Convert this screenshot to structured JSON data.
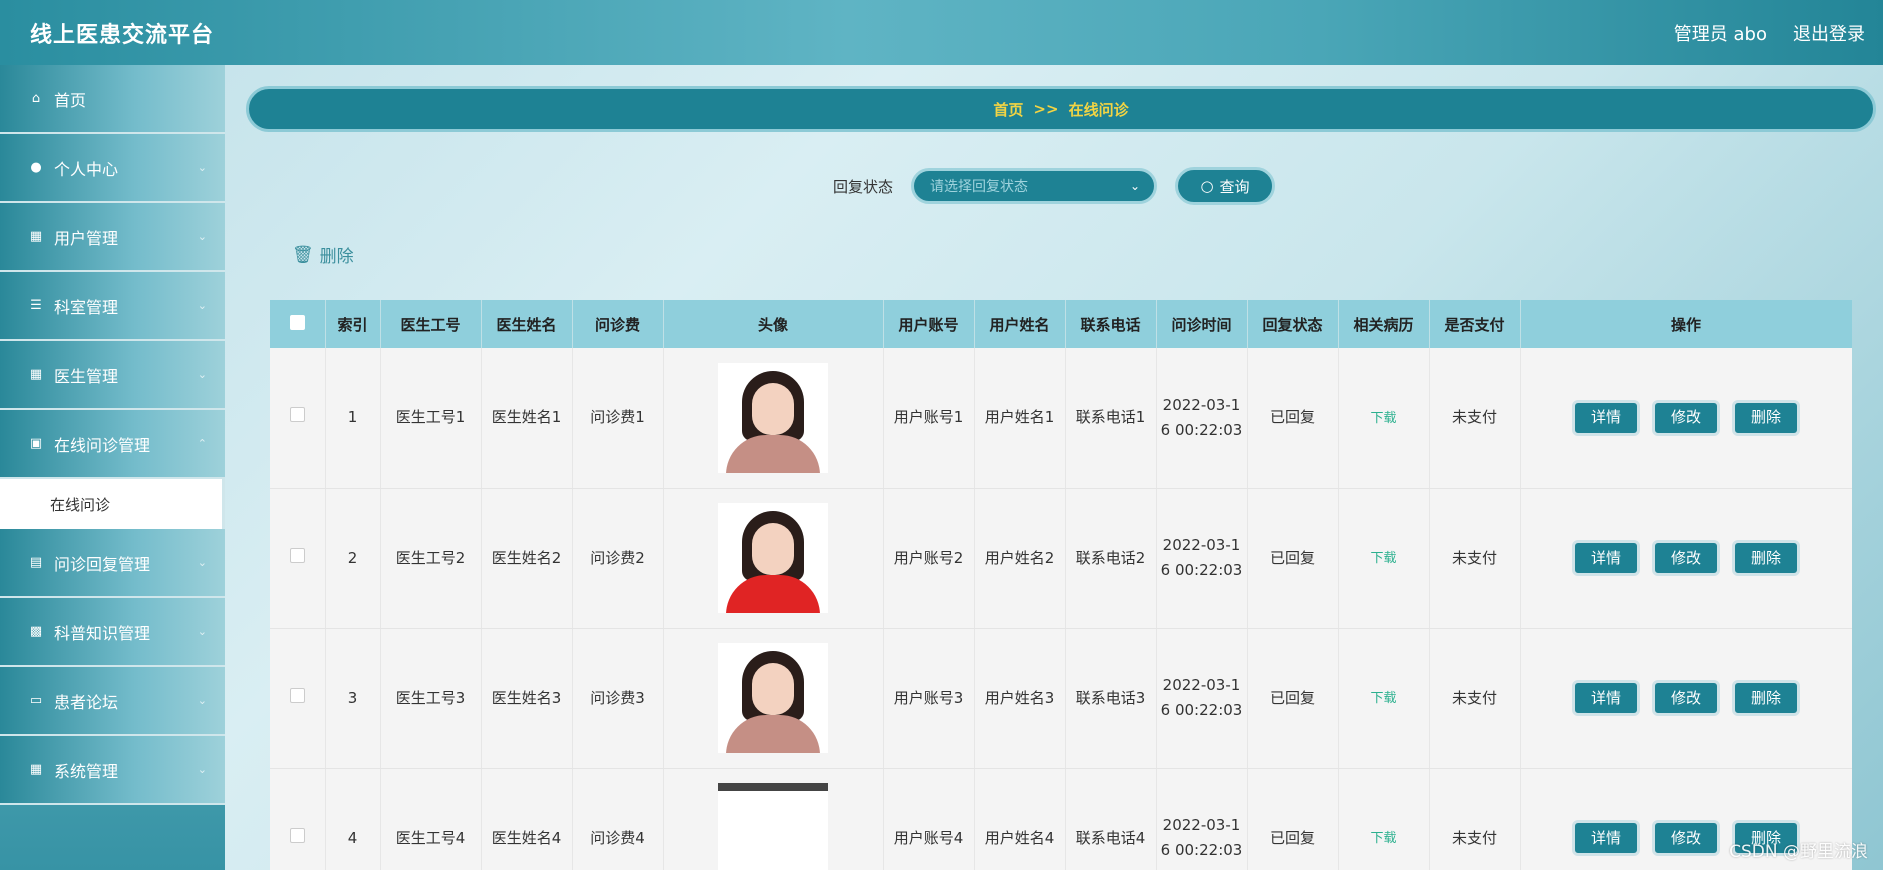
{
  "header": {
    "title": "线上医患交流平台",
    "user": "管理员 abo",
    "logout": "退出登录"
  },
  "sidebar": {
    "items": [
      {
        "label": "首页",
        "icon": "home-icon"
      },
      {
        "label": "个人中心",
        "icon": "user-icon"
      },
      {
        "label": "用户管理",
        "icon": "grid-icon"
      },
      {
        "label": "科室管理",
        "icon": "sliders-icon"
      },
      {
        "label": "医生管理",
        "icon": "grid-icon"
      },
      {
        "label": "在线问诊管理",
        "icon": "briefcase-icon"
      },
      {
        "label": "问诊回复管理",
        "icon": "document-icon"
      },
      {
        "label": "科普知识管理",
        "icon": "chat-icon"
      },
      {
        "label": "患者论坛",
        "icon": "monitor-icon"
      },
      {
        "label": "系统管理",
        "icon": "grid-icon"
      }
    ],
    "submenu": {
      "label": "在线问诊"
    }
  },
  "breadcrumb": {
    "home": "首页",
    "sep": ">>",
    "current": "在线问诊"
  },
  "search": {
    "label": "回复状态",
    "placeholder": "请选择回复状态",
    "button": "查询"
  },
  "toolbar": {
    "delete": "删除"
  },
  "table": {
    "headers": [
      "索引",
      "医生工号",
      "医生姓名",
      "问诊费",
      "头像",
      "用户账号",
      "用户姓名",
      "联系电话",
      "问诊时间",
      "回复状态",
      "相关病历",
      "是否支付",
      "操作"
    ],
    "actions": {
      "detail": "详情",
      "edit": "修改",
      "delete": "删除"
    },
    "rows": [
      {
        "index": "1",
        "doctor_id": "医生工号1",
        "doctor_name": "医生姓名1",
        "fee": "问诊费1",
        "account": "用户账号1",
        "username": "用户姓名1",
        "phone": "联系电话1",
        "time": "2022-03-16 00:22:03",
        "reply": "已回复",
        "record": "下载",
        "paid": "未支付"
      },
      {
        "index": "2",
        "doctor_id": "医生工号2",
        "doctor_name": "医生姓名2",
        "fee": "问诊费2",
        "account": "用户账号2",
        "username": "用户姓名2",
        "phone": "联系电话2",
        "time": "2022-03-16 00:22:03",
        "reply": "已回复",
        "record": "下载",
        "paid": "未支付"
      },
      {
        "index": "3",
        "doctor_id": "医生工号3",
        "doctor_name": "医生姓名3",
        "fee": "问诊费3",
        "account": "用户账号3",
        "username": "用户姓名3",
        "phone": "联系电话3",
        "time": "2022-03-16 00:22:03",
        "reply": "已回复",
        "record": "下载",
        "paid": "未支付"
      },
      {
        "index": "4",
        "doctor_id": "医生工号4",
        "doctor_name": "医生姓名4",
        "fee": "问诊费4",
        "account": "用户账号4",
        "username": "用户姓名4",
        "phone": "联系电话4",
        "time": "2022-03-16 00:22:03",
        "reply": "已回复",
        "record": "下载",
        "paid": "未支付"
      }
    ]
  },
  "watermark": "CSDN @野里流浪"
}
